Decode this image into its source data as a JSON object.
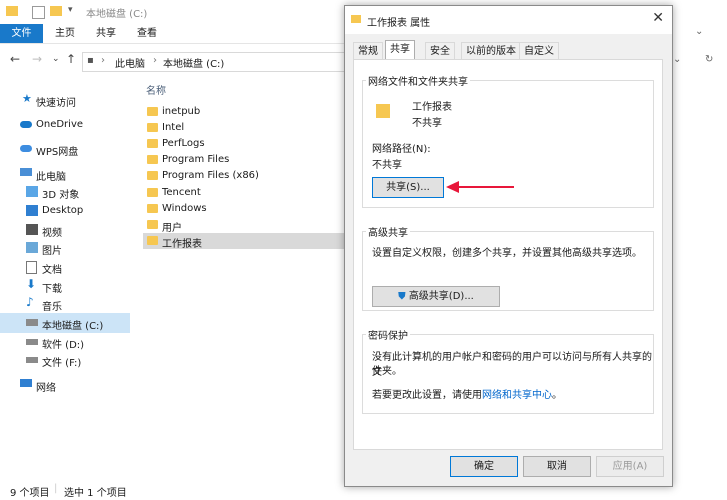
{
  "explorer": {
    "title": "本地磁盘 (C:)",
    "ribbon_tabs": [
      "文件",
      "主页",
      "共享",
      "查看"
    ],
    "breadcrumb": [
      "此电脑",
      "本地磁盘 (C:)"
    ],
    "sidebar": [
      {
        "label": "快速访问",
        "icon": "star-icon"
      },
      {
        "label": "OneDrive",
        "icon": "cloud-icon"
      },
      {
        "label": "WPS网盘",
        "icon": "cloud-icon"
      },
      {
        "label": "此电脑",
        "icon": "computer-icon"
      },
      {
        "label": "3D 对象",
        "icon": "cube-icon"
      },
      {
        "label": "Desktop",
        "icon": "desktop-icon"
      },
      {
        "label": "视频",
        "icon": "video-icon"
      },
      {
        "label": "图片",
        "icon": "picture-icon"
      },
      {
        "label": "文档",
        "icon": "document-icon"
      },
      {
        "label": "下载",
        "icon": "download-icon"
      },
      {
        "label": "音乐",
        "icon": "music-icon"
      },
      {
        "label": "本地磁盘 (C:)",
        "icon": "drive-icon"
      },
      {
        "label": "软件 (D:)",
        "icon": "drive-icon"
      },
      {
        "label": "文件 (F:)",
        "icon": "drive-icon"
      },
      {
        "label": "网络",
        "icon": "network-icon"
      }
    ],
    "column_header": "名称",
    "files": [
      "inetpub",
      "Intel",
      "PerfLogs",
      "Program Files",
      "Program Files (x86)",
      "Tencent",
      "Windows",
      "用户",
      "工作报表"
    ],
    "status_count": "9 个项目",
    "status_selected": "选中 1 个项目"
  },
  "dialog": {
    "title": "工作报表 属性",
    "tabs": [
      "常规",
      "共享",
      "安全",
      "以前的版本",
      "自定义"
    ],
    "net_group_label": "网络文件和文件夹共享",
    "folder_name": "工作报表",
    "folder_state": "不共享",
    "net_path_label": "网络路径(N):",
    "net_path_value": "不共享",
    "share_button": "共享(S)...",
    "adv_group_label": "高级共享",
    "adv_desc": "设置自定义权限，创建多个共享，并设置其他高级共享选项。",
    "adv_button": "高级共享(D)...",
    "pwd_group_label": "密码保护",
    "pwd_desc_1": "没有此计算机的用户帐户和密码的用户可以访问与所有人共享的文",
    "pwd_desc_2": "件夹。",
    "pwd_change_prefix": "若要更改此设置，请使用",
    "pwd_link": "网络和共享中心",
    "pwd_change_suffix": "。",
    "ok": "确定",
    "cancel": "取消",
    "apply": "应用(A)"
  },
  "colors": {
    "accent": "#1979ca",
    "arrow": "#e8173a",
    "folder": "#f6c751",
    "link": "#0066cc"
  }
}
